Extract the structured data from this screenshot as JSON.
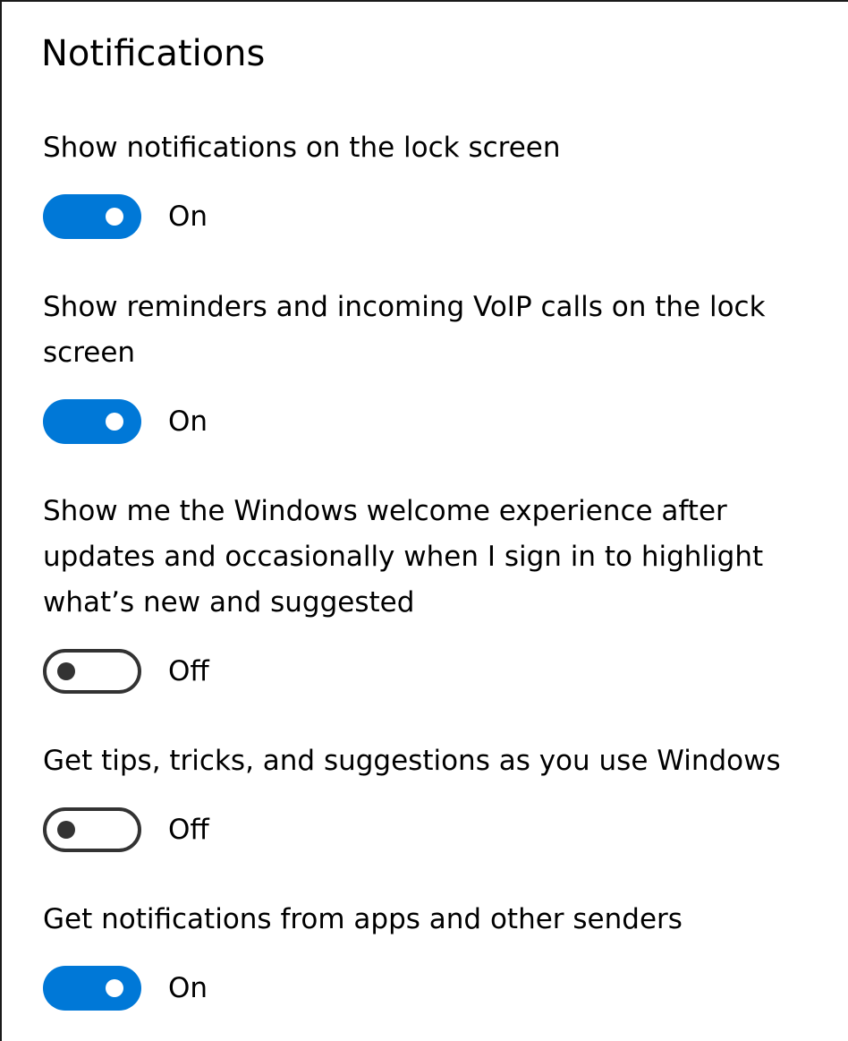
{
  "panel": {
    "title": "Notifications"
  },
  "accent_color": "#0078d7",
  "settings": [
    {
      "label": "Show notifications on the lock screen",
      "state": true,
      "state_label": "On"
    },
    {
      "label": "Show reminders and incoming VoIP calls on the lock screen",
      "state": true,
      "state_label": "On"
    },
    {
      "label": "Show me the Windows welcome experience after updates and occasionally when I sign in to highlight what’s new and suggested",
      "state": false,
      "state_label": "Off"
    },
    {
      "label": "Get tips, tricks, and suggestions as you use Windows",
      "state": false,
      "state_label": "Off"
    },
    {
      "label": "Get notifications from apps and other senders",
      "state": true,
      "state_label": "On"
    }
  ]
}
